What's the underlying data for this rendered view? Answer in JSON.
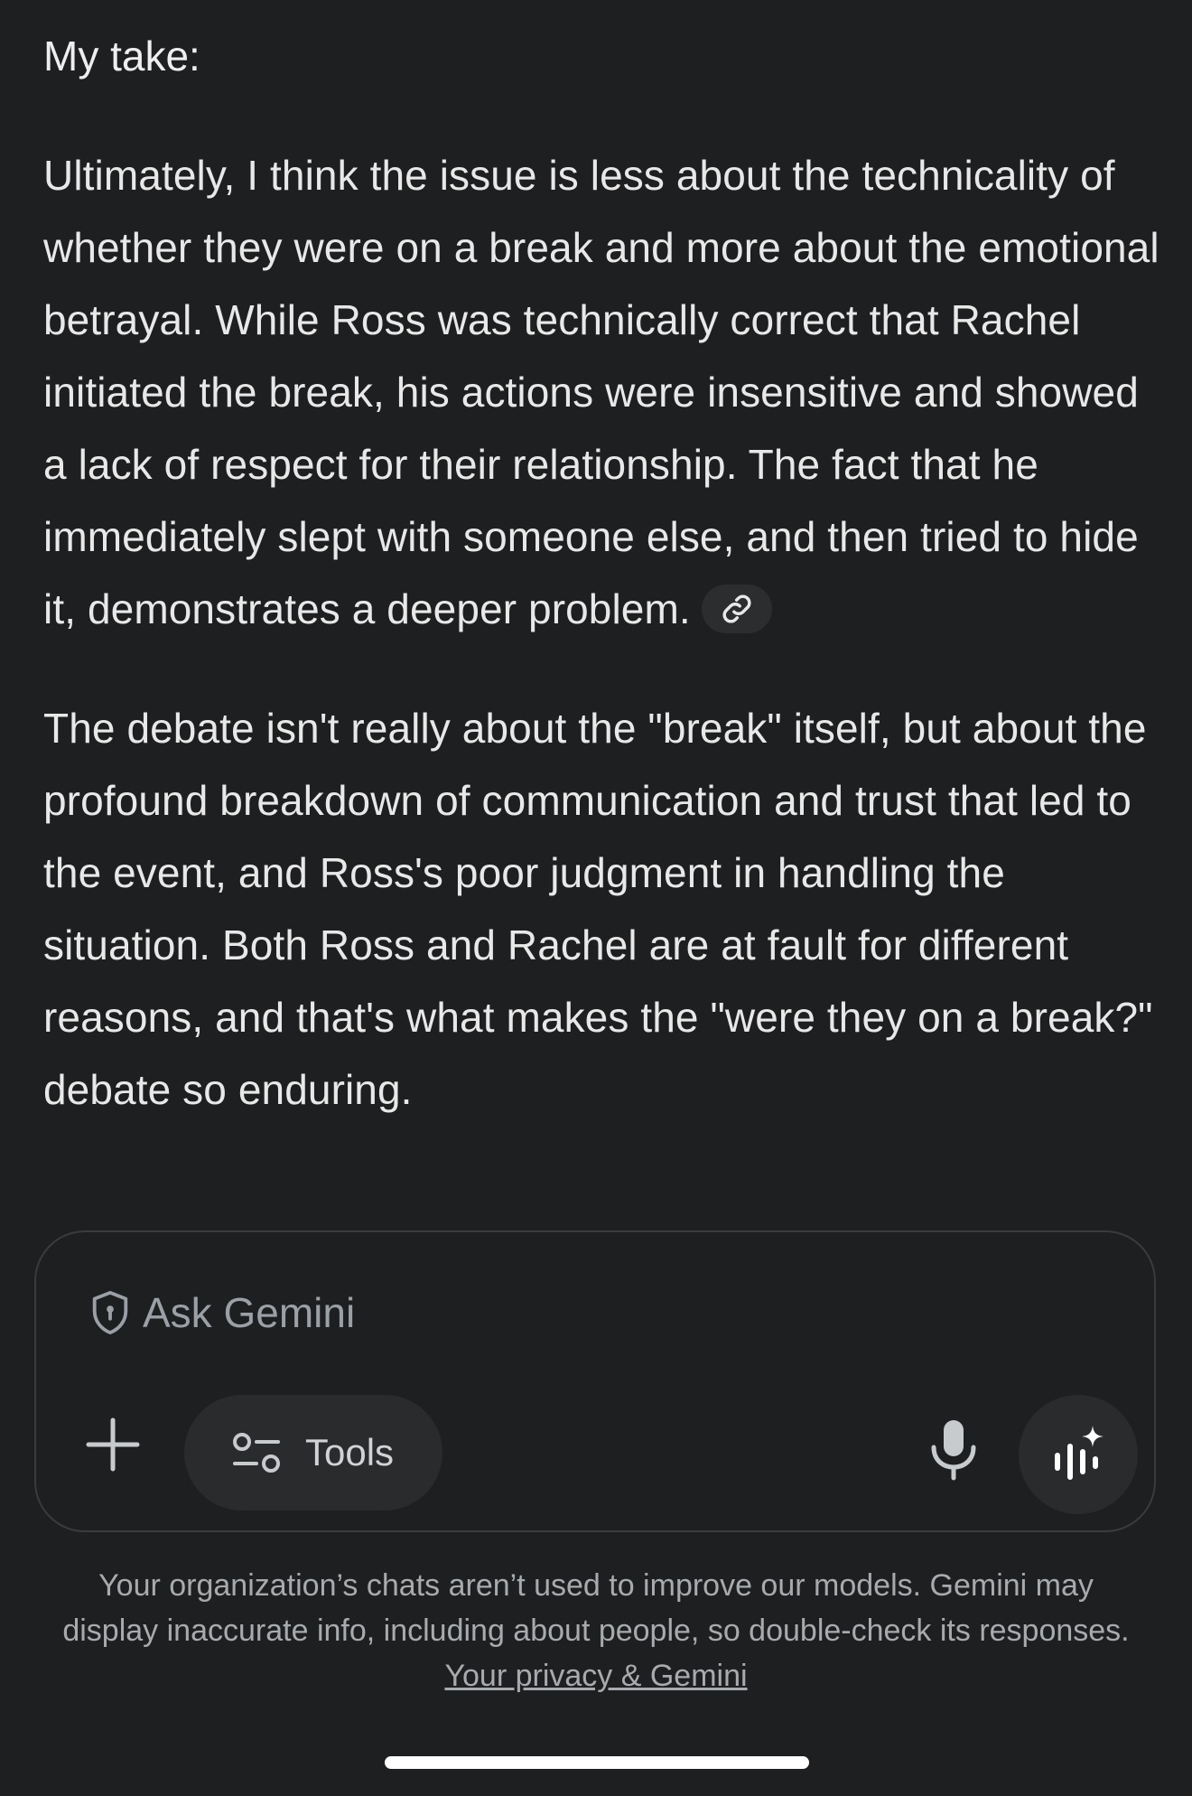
{
  "response": {
    "heading": "My take:",
    "paragraph1": "Ultimately, I think the issue is less about the technicality of whether they were on a break and more about the emotional betrayal. While Ross was technically correct that Rachel initiated the break, his actions were insensitive and showed a lack of respect for their relationship. The fact that he immediately slept with someone else, and then tried to hide it, demonstrates a deeper problem.",
    "paragraph2": "The debate isn't really about the \"break\" itself, but about the profound breakdown of communication and trust that led to the event, and Ross's poor judgment in handling the situation. Both Ross and Rachel are at fault for different reasons, and that's what makes the \"were they on a break?\" debate so enduring."
  },
  "composer": {
    "placeholder": "Ask Gemini",
    "tools_label": "Tools"
  },
  "icons": {
    "citation": "link-icon",
    "privacy": "shield-icon",
    "add": "plus-icon",
    "tools": "tools-sliders-icon",
    "mic": "microphone-icon",
    "live": "gemini-live-icon"
  },
  "footer": {
    "disclaimer": "Your organization’s chats aren’t used to improve our models. Gemini may display inaccurate info, including about people, so double-check its responses.",
    "privacy_link": "Your privacy & Gemini"
  },
  "colors": {
    "background": "#1e1f20",
    "text": "#e8e8e8",
    "muted_text": "#a8abae",
    "chip": "#2a2b2d",
    "border": "#3a3b3d"
  }
}
